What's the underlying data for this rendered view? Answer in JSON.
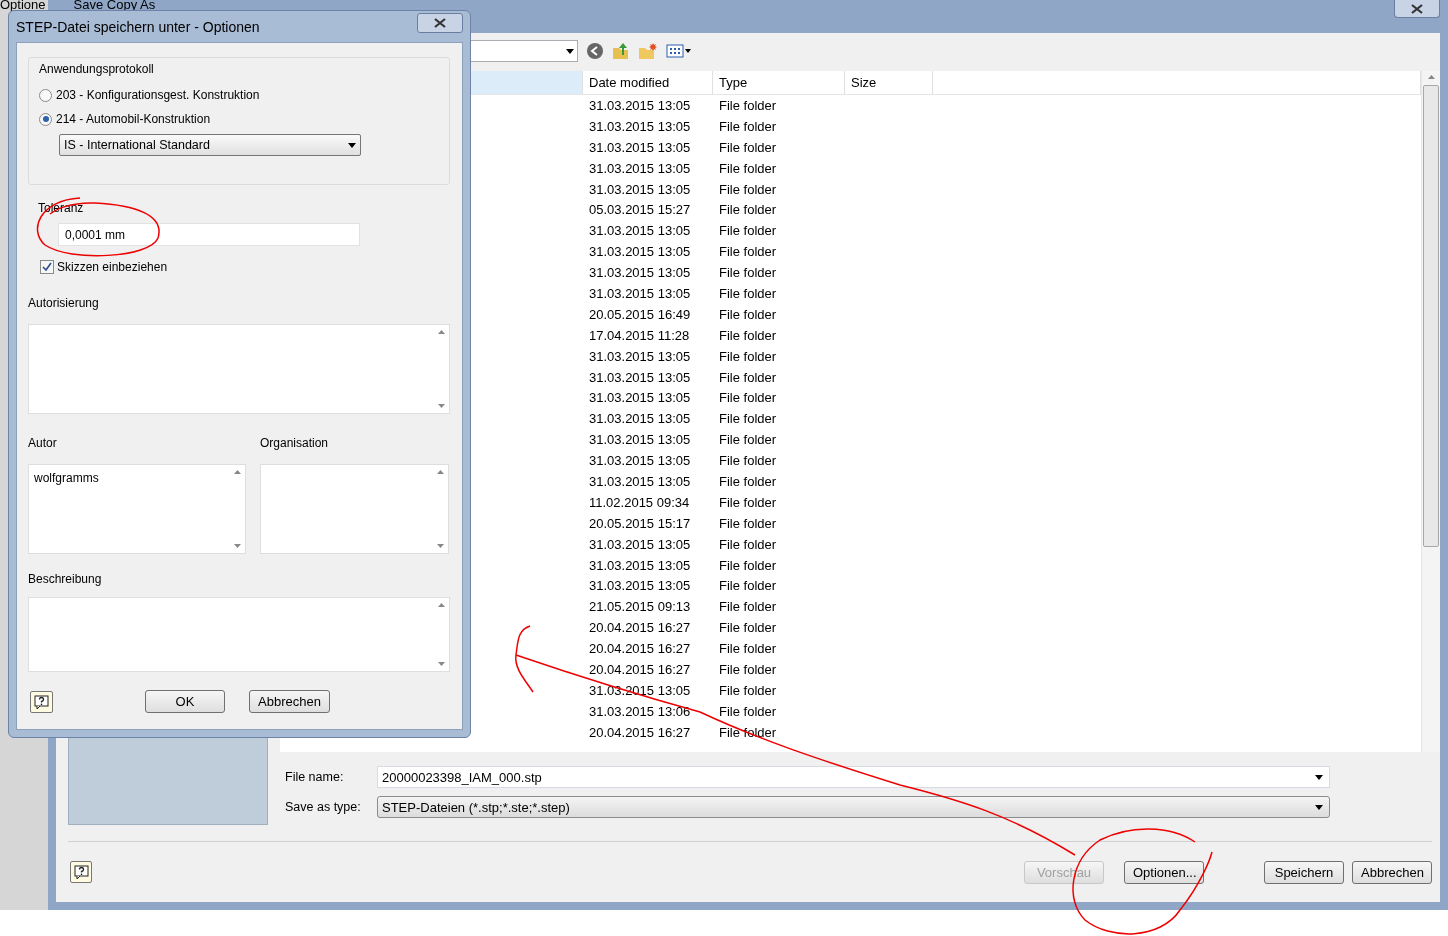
{
  "background_app": {
    "tab_texts": [
      "Optione",
      "Save Copy As"
    ]
  },
  "save_dialog": {
    "file_list": {
      "columns": [
        "Date modified",
        "Type",
        "Size"
      ],
      "rows": [
        {
          "date_modified": "31.03.2015 13:05",
          "type": "File folder"
        },
        {
          "date_modified": "31.03.2015 13:05",
          "type": "File folder"
        },
        {
          "date_modified": "31.03.2015 13:05",
          "type": "File folder"
        },
        {
          "date_modified": "31.03.2015 13:05",
          "type": "File folder"
        },
        {
          "date_modified": "31.03.2015 13:05",
          "type": "File folder"
        },
        {
          "date_modified": "05.03.2015 15:27",
          "type": "File folder"
        },
        {
          "date_modified": "31.03.2015 13:05",
          "type": "File folder"
        },
        {
          "date_modified": "31.03.2015 13:05",
          "type": "File folder"
        },
        {
          "date_modified": "31.03.2015 13:05",
          "type": "File folder"
        },
        {
          "date_modified": "31.03.2015 13:05",
          "type": "File folder"
        },
        {
          "date_modified": "20.05.2015 16:49",
          "type": "File folder"
        },
        {
          "date_modified": "17.04.2015 11:28",
          "type": "File folder"
        },
        {
          "date_modified": "31.03.2015 13:05",
          "type": "File folder"
        },
        {
          "date_modified": "31.03.2015 13:05",
          "type": "File folder"
        },
        {
          "date_modified": "31.03.2015 13:05",
          "type": "File folder"
        },
        {
          "date_modified": "31.03.2015 13:05",
          "type": "File folder"
        },
        {
          "date_modified": "31.03.2015 13:05",
          "type": "File folder"
        },
        {
          "date_modified": "31.03.2015 13:05",
          "type": "File folder"
        },
        {
          "date_modified": "31.03.2015 13:05",
          "type": "File folder"
        },
        {
          "date_modified": "11.02.2015 09:34",
          "type": "File folder"
        },
        {
          "date_modified": "20.05.2015 15:17",
          "type": "File folder"
        },
        {
          "date_modified": "31.03.2015 13:05",
          "type": "File folder"
        },
        {
          "date_modified": "31.03.2015 13:05",
          "type": "File folder"
        },
        {
          "date_modified": "31.03.2015 13:05",
          "type": "File folder"
        },
        {
          "date_modified": "21.05.2015 09:13",
          "type": "File folder"
        },
        {
          "date_modified": "20.04.2015 16:27",
          "type": "File folder"
        },
        {
          "date_modified": "20.04.2015 16:27",
          "type": "File folder"
        },
        {
          "date_modified": "20.04.2015 16:27",
          "type": "File folder"
        },
        {
          "date_modified": "31.03.2015 13:05",
          "type": "File folder"
        },
        {
          "date_modified": "31.03.2015 13:06",
          "type": "File folder"
        },
        {
          "date_modified": "20.04.2015 16:27",
          "type": "File folder"
        }
      ]
    },
    "file_name": {
      "label": "File name:",
      "value": "20000023398_IAM_000.stp"
    },
    "save_as_type": {
      "label": "Save as type:",
      "value": "STEP-Dateien (*.stp;*.ste;*.step)"
    },
    "buttons": [
      {
        "label": "Vorschau",
        "disabled": true
      },
      {
        "label": "Optionen...",
        "disabled": false
      },
      {
        "label": "Speichern",
        "disabled": false
      },
      {
        "label": "Abbrechen",
        "disabled": false
      }
    ]
  },
  "options_dialog": {
    "title": "STEP-Datei speichern unter - Optionen",
    "protocol_group": {
      "title": "Anwendungsprotokoll",
      "options": [
        {
          "label": "203 - Konfigurationsgest. Konstruktion",
          "selected": false
        },
        {
          "label": "214 - Automobil-Konstruktion",
          "selected": true
        }
      ],
      "standard": "IS - International Standard"
    },
    "tolerance": {
      "label": "Toleranz",
      "value": "0,0001 mm"
    },
    "include_sketches": {
      "label": "Skizzen einbeziehen",
      "checked": true
    },
    "authorization": {
      "label": "Autorisierung"
    },
    "author": {
      "label": "Autor",
      "value": "wolfgramms"
    },
    "organisation": {
      "label": "Organisation"
    },
    "description": {
      "label": "Beschreibung"
    },
    "buttons": [
      "OK",
      "Abbrechen"
    ]
  }
}
